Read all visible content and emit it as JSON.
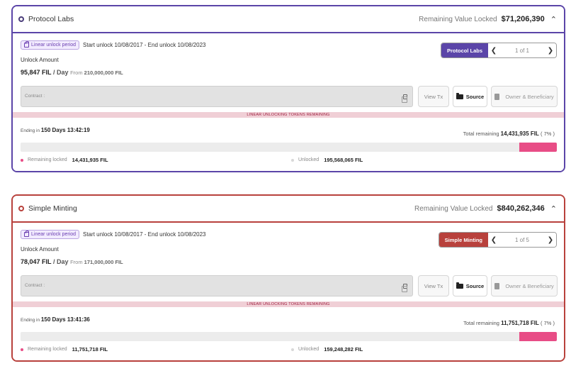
{
  "cards": [
    {
      "name": "Protocol Labs",
      "remaining_label": "Remaining Value Locked",
      "remaining_value": "$71,206,390",
      "badge": "Linear unlock period",
      "dates": "Start unlock 10/08/2017 - End unlock 10/08/2023",
      "unlock_label": "Unlock Amount",
      "rate": "95,847 FIL",
      "per_day": "/ Day",
      "from_label": "From",
      "from_value": "210,000,000 FIL",
      "pager_title": "Protocol Labs",
      "pager_count": "1 of 1",
      "contract_label": "Contract :",
      "view_tx": "View Tx",
      "source": "Source",
      "owner": "Owner & Beneficiary",
      "banner": "LINEAR UNLOCKING TOKENS REMAINING",
      "ending_label": "Ending in",
      "ending_value": "150 Days 13:42:19",
      "total_label": "Total remaining",
      "total_value": "14,431,935 FIL",
      "total_pct": "( 7% )",
      "locked_fraction": 0.07,
      "locked_label": "Remaining locked",
      "locked_value": "14,431,935 FIL",
      "unlocked_label": "Unlocked",
      "unlocked_value": "195,568,065 FIL",
      "accent": "#5b45a8"
    },
    {
      "name": "Simple Minting",
      "remaining_label": "Remaining Value Locked",
      "remaining_value": "$840,262,346",
      "badge": "Linear unlock period",
      "dates": "Start unlock 10/08/2017 - End unlock 10/08/2023",
      "unlock_label": "Unlock Amount",
      "rate": "78,047 FIL",
      "per_day": "/ Day",
      "from_label": "From",
      "from_value": "171,000,000 FIL",
      "pager_title": "Simple Minting",
      "pager_count": "1 of 5",
      "contract_label": "Contract :",
      "view_tx": "View Tx",
      "source": "Source",
      "owner": "Owner & Beneficiary",
      "banner": "LINEAR UNLOCKING TOKENS REMAINING",
      "ending_label": "Ending in",
      "ending_value": "150 Days 13:41:36",
      "total_label": "Total remaining",
      "total_value": "11,751,718 FIL",
      "total_pct": "( 7% )",
      "locked_fraction": 0.07,
      "locked_label": "Remaining locked",
      "locked_value": "11,751,718 FIL",
      "unlocked_label": "Unlocked",
      "unlocked_value": "159,248,282 FIL",
      "accent": "#b8413c"
    }
  ]
}
